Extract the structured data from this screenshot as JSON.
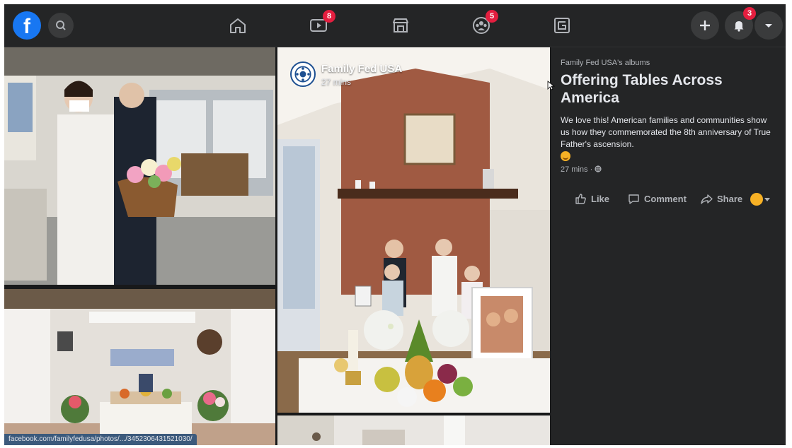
{
  "app": {
    "logo_letter": "f"
  },
  "nav": {
    "icons": [
      "home-icon",
      "watch-icon",
      "marketplace-icon",
      "groups-icon",
      "gaming-icon"
    ],
    "watch_badge": "8",
    "groups_badge": "5",
    "notifications_badge": "3"
  },
  "photo": {
    "page_name": "Family Fed USA",
    "time": "27 mins",
    "link_preview": "facebook.com/familyfedusa/photos/.../3452306431521030/"
  },
  "post": {
    "album_source": "Family Fed USA's albums",
    "title": "Offering Tables Across America",
    "body": "We love this! American families and communities show us how they commemorated the 8th anniversary of True Father's ascension.",
    "meta": "27 mins · ",
    "actions": {
      "like": "Like",
      "comment": "Comment",
      "share": "Share"
    }
  },
  "colors": {
    "brand": "#1877f2",
    "badge": "#e41e3f",
    "panel": "#242526",
    "page": "#18191a",
    "text": "#e4e6eb",
    "muted": "#b0b3b8"
  }
}
